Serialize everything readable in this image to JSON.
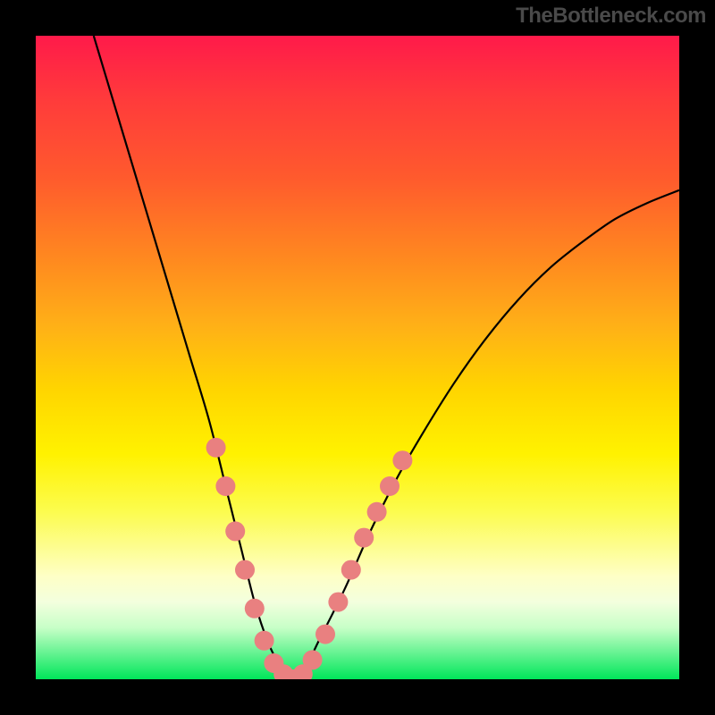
{
  "watermark": "TheBottleneck.com",
  "chart_data": {
    "type": "line",
    "title": "",
    "xlabel": "",
    "ylabel": "",
    "xlim": [
      0,
      100
    ],
    "ylim": [
      0,
      100
    ],
    "series": [
      {
        "name": "curve",
        "x": [
          9,
          12,
          15,
          18,
          21,
          24,
          27,
          30,
          32,
          34,
          36,
          38,
          40,
          42,
          44,
          48,
          52,
          56,
          60,
          65,
          70,
          75,
          80,
          85,
          90,
          95,
          100
        ],
        "y": [
          100,
          90,
          80,
          70,
          60,
          50,
          40,
          28,
          20,
          12,
          6,
          2,
          0,
          2,
          6,
          14,
          23,
          31,
          38,
          46,
          53,
          59,
          64,
          68,
          71.5,
          74,
          76
        ]
      }
    ],
    "markers": [
      {
        "x": 28,
        "y": 36
      },
      {
        "x": 29.5,
        "y": 30
      },
      {
        "x": 31,
        "y": 23
      },
      {
        "x": 32.5,
        "y": 17
      },
      {
        "x": 34,
        "y": 11
      },
      {
        "x": 35.5,
        "y": 6
      },
      {
        "x": 37,
        "y": 2.5
      },
      {
        "x": 38.5,
        "y": 0.8
      },
      {
        "x": 40,
        "y": 0
      },
      {
        "x": 41.5,
        "y": 0.8
      },
      {
        "x": 43,
        "y": 3
      },
      {
        "x": 45,
        "y": 7
      },
      {
        "x": 47,
        "y": 12
      },
      {
        "x": 49,
        "y": 17
      },
      {
        "x": 51,
        "y": 22
      },
      {
        "x": 53,
        "y": 26
      },
      {
        "x": 55,
        "y": 30
      },
      {
        "x": 57,
        "y": 34
      }
    ],
    "marker_color": "#e98080",
    "curve_color": "#000000",
    "gradient_stops": [
      {
        "pos": 0,
        "color": "#ff1a4a"
      },
      {
        "pos": 10,
        "color": "#ff3b3b"
      },
      {
        "pos": 22,
        "color": "#ff5a2d"
      },
      {
        "pos": 35,
        "color": "#ff8a1f"
      },
      {
        "pos": 45,
        "color": "#ffb017"
      },
      {
        "pos": 55,
        "color": "#ffd500"
      },
      {
        "pos": 65,
        "color": "#fff200"
      },
      {
        "pos": 74,
        "color": "#fcfc4f"
      },
      {
        "pos": 79,
        "color": "#fdfd8a"
      },
      {
        "pos": 84,
        "color": "#feffc6"
      },
      {
        "pos": 88,
        "color": "#f3ffde"
      },
      {
        "pos": 92,
        "color": "#c7ffc7"
      },
      {
        "pos": 100,
        "color": "#00e65a"
      }
    ]
  }
}
